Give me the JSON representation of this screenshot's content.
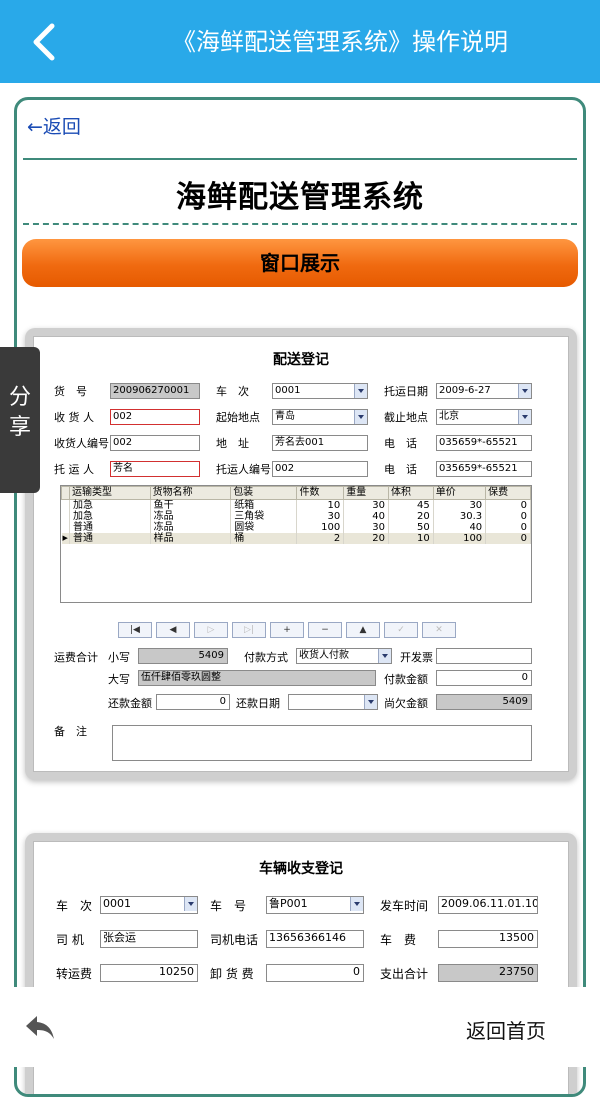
{
  "topbar": {
    "title": "《海鲜配送管理系统》操作说明"
  },
  "content": {
    "back_link": "←返回",
    "doc_title": "海鲜配送管理系统",
    "section_title": "窗口展示"
  },
  "share": {
    "label": "分享"
  },
  "screen1": {
    "title": "配送登记",
    "cargo_no_label": "货　号",
    "cargo_no": "200906270001",
    "trip_label": "车　次",
    "trip": "0001",
    "ship_date_label": "托运日期",
    "ship_date": "2009-6-27",
    "consignee_label": "收 货 人",
    "consignee": "002",
    "origin_label": "起始地点",
    "origin": "青岛",
    "dest_label": "截止地点",
    "dest": "北京",
    "consignee_no_label": "收货人编号",
    "consignee_no": "002",
    "address_label": "地　址",
    "address": "芳名去001",
    "phone_label": "电　话",
    "phone": "035659*-65521",
    "shipper_label": "托 运 人",
    "shipper": "芳名",
    "shipper_no_label": "托运人编号",
    "shipper_no": "002",
    "phone2_label": "电　话",
    "phone2": "035659*-65521",
    "grid": {
      "columns": [
        "运输类型",
        "货物名称",
        "包装",
        "件数",
        "重量",
        "体积",
        "单价",
        "保费"
      ],
      "rows": [
        [
          "加急",
          "鱼干",
          "纸箱",
          "10",
          "30",
          "45",
          "30",
          "0"
        ],
        [
          "加急",
          "冻品",
          "三角袋",
          "30",
          "40",
          "20",
          "30.3",
          "0"
        ],
        [
          "普通",
          "冻品",
          "圆袋",
          "100",
          "30",
          "50",
          "40",
          "0"
        ],
        [
          "普通",
          "样品",
          "桶",
          "2",
          "20",
          "10",
          "100",
          "0"
        ]
      ]
    },
    "nav_buttons": [
      "|◀",
      "◀",
      "▷",
      "▷|",
      "+",
      "−",
      "▲",
      "✓",
      "✕"
    ],
    "freight_total_label": "运费合计",
    "small_label": "小写",
    "small_value": "5409",
    "pay_method_label": "付款方式",
    "pay_method": "收货人付款",
    "invoice_label": "开发票",
    "invoice": "",
    "big_label": "大写",
    "big_value": "伍仟肆佰零玖圆整",
    "paid_amount_label": "付款金额",
    "paid_amount": "0",
    "repay_label": "还款金额",
    "repay": "0",
    "repay_date_label": "还款日期",
    "repay_date": "",
    "owed_label": "尚欠金额",
    "owed": "5409",
    "remark_label": "备　注"
  },
  "screen2": {
    "title": "车辆收支登记",
    "trip_label": "车　次",
    "trip": "0001",
    "plate_label": "车　号",
    "plate": "鲁P001",
    "depart_label": "发车时间",
    "depart": "2009.06.11.01.10",
    "driver_label": "司 机",
    "driver": "张会运",
    "driver_phone_label": "司机电话",
    "driver_phone": "13656366146",
    "fare_label": "车　费",
    "fare": "13500",
    "transfer_label": "转运费",
    "transfer": "10250",
    "unload_label": "卸 货 费",
    "unload": "0",
    "expense_label": "支出合计",
    "expense": "23750"
  },
  "bottombar": {
    "home_label": "返回首页"
  }
}
